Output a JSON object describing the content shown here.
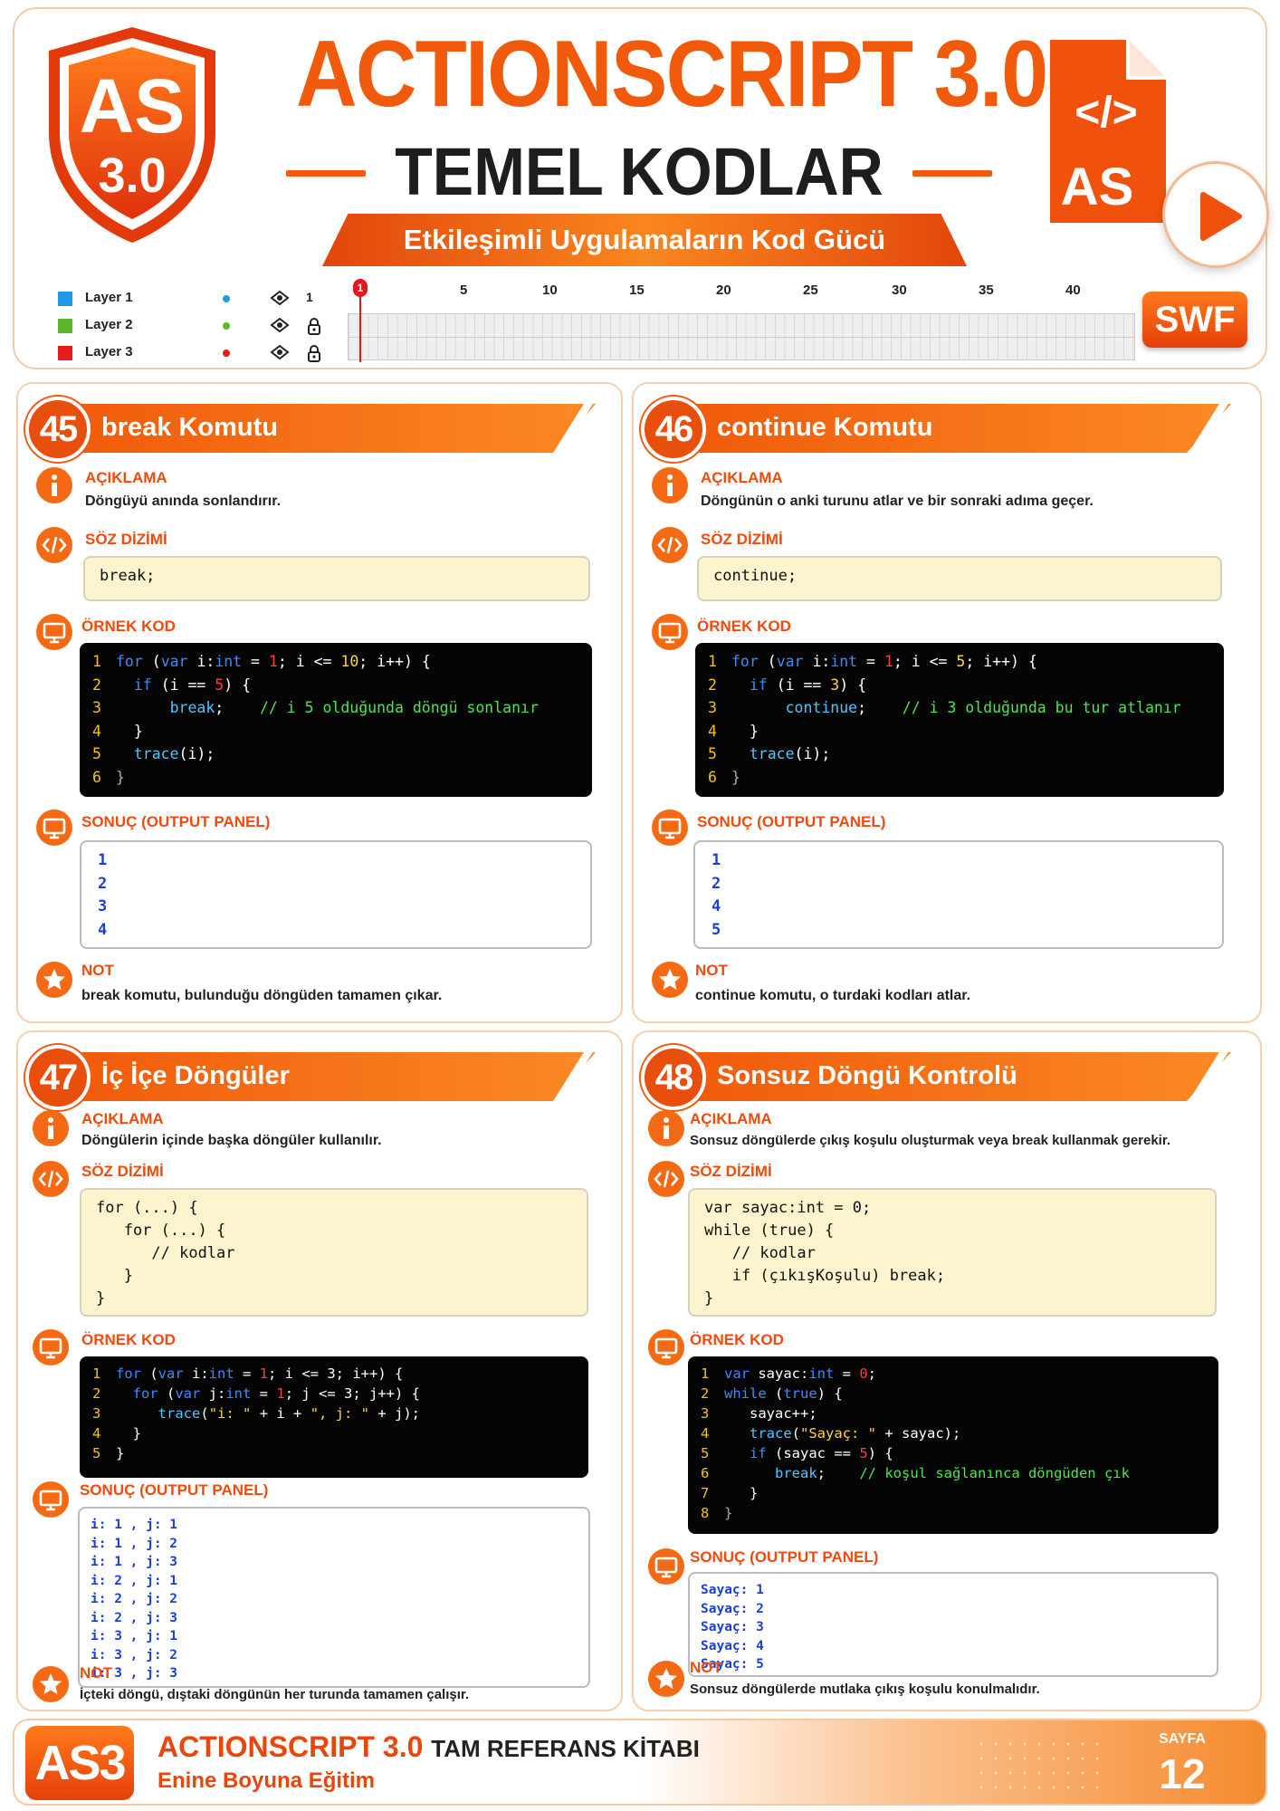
{
  "header": {
    "shield_line1": "AS",
    "shield_line2": "3.0",
    "title": "ACTIONSCRIPT 3.0",
    "subtitle": "TEMEL KODLAR",
    "tagline": "Etkileşimli Uygulamaların Kod Gücü",
    "file_icon_code": "</>",
    "file_icon_label": "AS",
    "swf_label": "SWF"
  },
  "timeline": {
    "layers": [
      {
        "name": "Layer 1",
        "color": "#1e9be8",
        "lock": "1"
      },
      {
        "name": "Layer 2",
        "color": "#5cb82a",
        "lock": ""
      },
      {
        "name": "Layer 3",
        "color": "#e41c1c",
        "lock": ""
      }
    ],
    "playhead": "1",
    "ticks": [
      "5",
      "10",
      "15",
      "20",
      "25",
      "30",
      "35",
      "40"
    ]
  },
  "labels": {
    "aciklama": "AÇIKLAMA",
    "soz_dizimi": "SÖZ DİZİMİ",
    "ornek_kod": "ÖRNEK KOD",
    "sonuc": "SONUÇ (OUTPUT PANEL)",
    "not": "NOT"
  },
  "cards": [
    {
      "number": "45",
      "title": "break Komutu",
      "description": "Döngüyü anında sonlandırır.",
      "syntax": "break;",
      "output": "1\n2\n3\n4",
      "note": "break komutu, bulunduğu döngüden tamamen çıkar."
    },
    {
      "number": "46",
      "title": "continue Komutu",
      "description": "Döngünün o anki turunu atlar ve bir sonraki adıma geçer.",
      "syntax": "continue;",
      "output": "1\n2\n4\n5",
      "note": "continue komutu, o turdaki kodları atlar."
    },
    {
      "number": "47",
      "title": "İç İçe Döngüler",
      "description": "Döngülerin içinde başka döngüler kullanılır.",
      "syntax": "for (...) {\n   for (...) {\n      // kodlar\n   }\n}",
      "output": "i: 1 , j: 1\ni: 1 , j: 2\ni: 1 , j: 3\ni: 2 , j: 1\ni: 2 , j: 2\ni: 2 , j: 3\ni: 3 , j: 1\ni: 3 , j: 2\ni: 3 , j: 3",
      "note": "İçteki döngü, dıştaki döngünün her turunda tamamen çalışır."
    },
    {
      "number": "48",
      "title": "Sonsuz Döngü Kontrolü",
      "description": "Sonsuz döngülerde çıkış koşulu oluşturmak veya break kullanmak gerekir.",
      "syntax": "var sayac:int = 0;\nwhile (true) {\n   // kodlar\n   if (çıkışKoşulu) break;\n}",
      "output": "Sayaç: 1\nSayaç: 2\nSayaç: 3\nSayaç: 4\nSayaç: 5",
      "note": "Sonsuz döngülerde mutlaka çıkış koşulu konulmalıdır."
    }
  ],
  "code": {
    "c45": [
      [
        [
          "ln",
          "1"
        ],
        [
          "kw",
          "for "
        ],
        [
          "tx",
          "("
        ],
        [
          "kw",
          "var "
        ],
        [
          "tx",
          "i:"
        ],
        [
          "ty",
          "int"
        ],
        [
          "tx",
          " = "
        ],
        [
          "nm",
          "1"
        ],
        [
          "tx",
          "; i <= "
        ],
        [
          "st",
          "10"
        ],
        [
          "tx",
          "; i++) {"
        ]
      ],
      [
        [
          "ln",
          "2"
        ],
        [
          "tx",
          "  "
        ],
        [
          "kw",
          "if "
        ],
        [
          "tx",
          "(i == "
        ],
        [
          "nm",
          "5"
        ],
        [
          "tx",
          ") {"
        ]
      ],
      [
        [
          "ln",
          "3"
        ],
        [
          "tx",
          "      "
        ],
        [
          "fn",
          "break"
        ],
        [
          "tx",
          ";    "
        ],
        [
          "cm",
          "// i 5 olduğunda döngü sonlanır"
        ]
      ],
      [
        [
          "ln",
          "4"
        ],
        [
          "tx",
          "  }"
        ]
      ],
      [
        [
          "ln",
          "5"
        ],
        [
          "tx",
          "  "
        ],
        [
          "fn",
          "trace"
        ],
        [
          "tx",
          "(i);"
        ]
      ],
      [
        [
          "ln",
          "6"
        ],
        [
          "gr",
          "}"
        ]
      ]
    ],
    "c46": [
      [
        [
          "ln",
          "1"
        ],
        [
          "kw",
          "for "
        ],
        [
          "tx",
          "("
        ],
        [
          "kw",
          "var "
        ],
        [
          "tx",
          "i:"
        ],
        [
          "ty",
          "int"
        ],
        [
          "tx",
          " = "
        ],
        [
          "nm",
          "1"
        ],
        [
          "tx",
          "; i <= "
        ],
        [
          "st",
          "5"
        ],
        [
          "tx",
          "; i++) {"
        ]
      ],
      [
        [
          "ln",
          "2"
        ],
        [
          "tx",
          "  "
        ],
        [
          "kw",
          "if "
        ],
        [
          "tx",
          "(i == "
        ],
        [
          "st",
          "3"
        ],
        [
          "tx",
          ") {"
        ]
      ],
      [
        [
          "ln",
          "3"
        ],
        [
          "tx",
          "      "
        ],
        [
          "fn",
          "continue"
        ],
        [
          "tx",
          ";    "
        ],
        [
          "cm",
          "// i 3 olduğunda bu tur atlanır"
        ]
      ],
      [
        [
          "ln",
          "4"
        ],
        [
          "tx",
          "  }"
        ]
      ],
      [
        [
          "ln",
          "5"
        ],
        [
          "tx",
          "  "
        ],
        [
          "fn",
          "trace"
        ],
        [
          "tx",
          "(i);"
        ]
      ],
      [
        [
          "ln",
          "6"
        ],
        [
          "gr",
          "}"
        ]
      ]
    ],
    "c47": [
      [
        [
          "ln",
          "1"
        ],
        [
          "kw",
          "for "
        ],
        [
          "tx",
          "("
        ],
        [
          "kw",
          "var "
        ],
        [
          "tx",
          "i:"
        ],
        [
          "ty",
          "int"
        ],
        [
          "tx",
          " = "
        ],
        [
          "nm",
          "1"
        ],
        [
          "tx",
          "; i <= 3; i++) {"
        ]
      ],
      [
        [
          "ln",
          "2"
        ],
        [
          "tx",
          "  "
        ],
        [
          "kw",
          "for "
        ],
        [
          "tx",
          "("
        ],
        [
          "kw",
          "var "
        ],
        [
          "tx",
          "j:"
        ],
        [
          "ty",
          "int"
        ],
        [
          "tx",
          " = "
        ],
        [
          "nm",
          "1"
        ],
        [
          "tx",
          "; j <= 3; j++) {"
        ]
      ],
      [
        [
          "ln",
          "3"
        ],
        [
          "tx",
          "     "
        ],
        [
          "fn",
          "trace"
        ],
        [
          "tx",
          "("
        ],
        [
          "st",
          "\"i: \""
        ],
        [
          "tx",
          " + i + "
        ],
        [
          "st",
          "\", j: \""
        ],
        [
          "tx",
          " + j);"
        ]
      ],
      [
        [
          "ln",
          "4"
        ],
        [
          "tx",
          "  }"
        ]
      ],
      [
        [
          "ln",
          "5"
        ],
        [
          "tx",
          "}"
        ]
      ]
    ],
    "c48": [
      [
        [
          "ln",
          "1"
        ],
        [
          "kw",
          "var "
        ],
        [
          "tx",
          "sayac:"
        ],
        [
          "ty",
          "int"
        ],
        [
          "tx",
          " = "
        ],
        [
          "nm",
          "0"
        ],
        [
          "tx",
          ";"
        ]
      ],
      [
        [
          "ln",
          "2"
        ],
        [
          "kw",
          "while "
        ],
        [
          "tx",
          "("
        ],
        [
          "kw",
          "true"
        ],
        [
          "tx",
          ") {"
        ]
      ],
      [
        [
          "ln",
          "3"
        ],
        [
          "tx",
          "   sayac++;"
        ]
      ],
      [
        [
          "ln",
          "4"
        ],
        [
          "tx",
          "   "
        ],
        [
          "fn",
          "trace"
        ],
        [
          "tx",
          "("
        ],
        [
          "st",
          "\"Sayaç: \""
        ],
        [
          "tx",
          " + sayac);"
        ]
      ],
      [
        [
          "ln",
          "5"
        ],
        [
          "tx",
          "   "
        ],
        [
          "kw",
          "if "
        ],
        [
          "tx",
          "(sayac == "
        ],
        [
          "nm",
          "5"
        ],
        [
          "tx",
          ") {"
        ]
      ],
      [
        [
          "ln",
          "6"
        ],
        [
          "tx",
          "      "
        ],
        [
          "fn",
          "break"
        ],
        [
          "tx",
          ";    "
        ],
        [
          "cm",
          "// koşul sağlanınca döngüden çık"
        ]
      ],
      [
        [
          "ln",
          "7"
        ],
        [
          "tx",
          "   }"
        ]
      ],
      [
        [
          "ln",
          "8"
        ],
        [
          "gr",
          "}"
        ]
      ]
    ]
  },
  "footer": {
    "logo": "AS3",
    "title": "ACTIONSCRIPT 3.0",
    "title_suffix": "TAM REFERANS KİTABI",
    "tagline": "Enine Boyuna Eğitim",
    "page_label": "SAYFA",
    "page_number": "12"
  },
  "colors": {
    "accent": "#f15a0a",
    "accent_light": "#fb8a25",
    "syntax_bg": "#fcf3cf",
    "code_bg": "#050505",
    "output_text": "#1a3fd6"
  }
}
